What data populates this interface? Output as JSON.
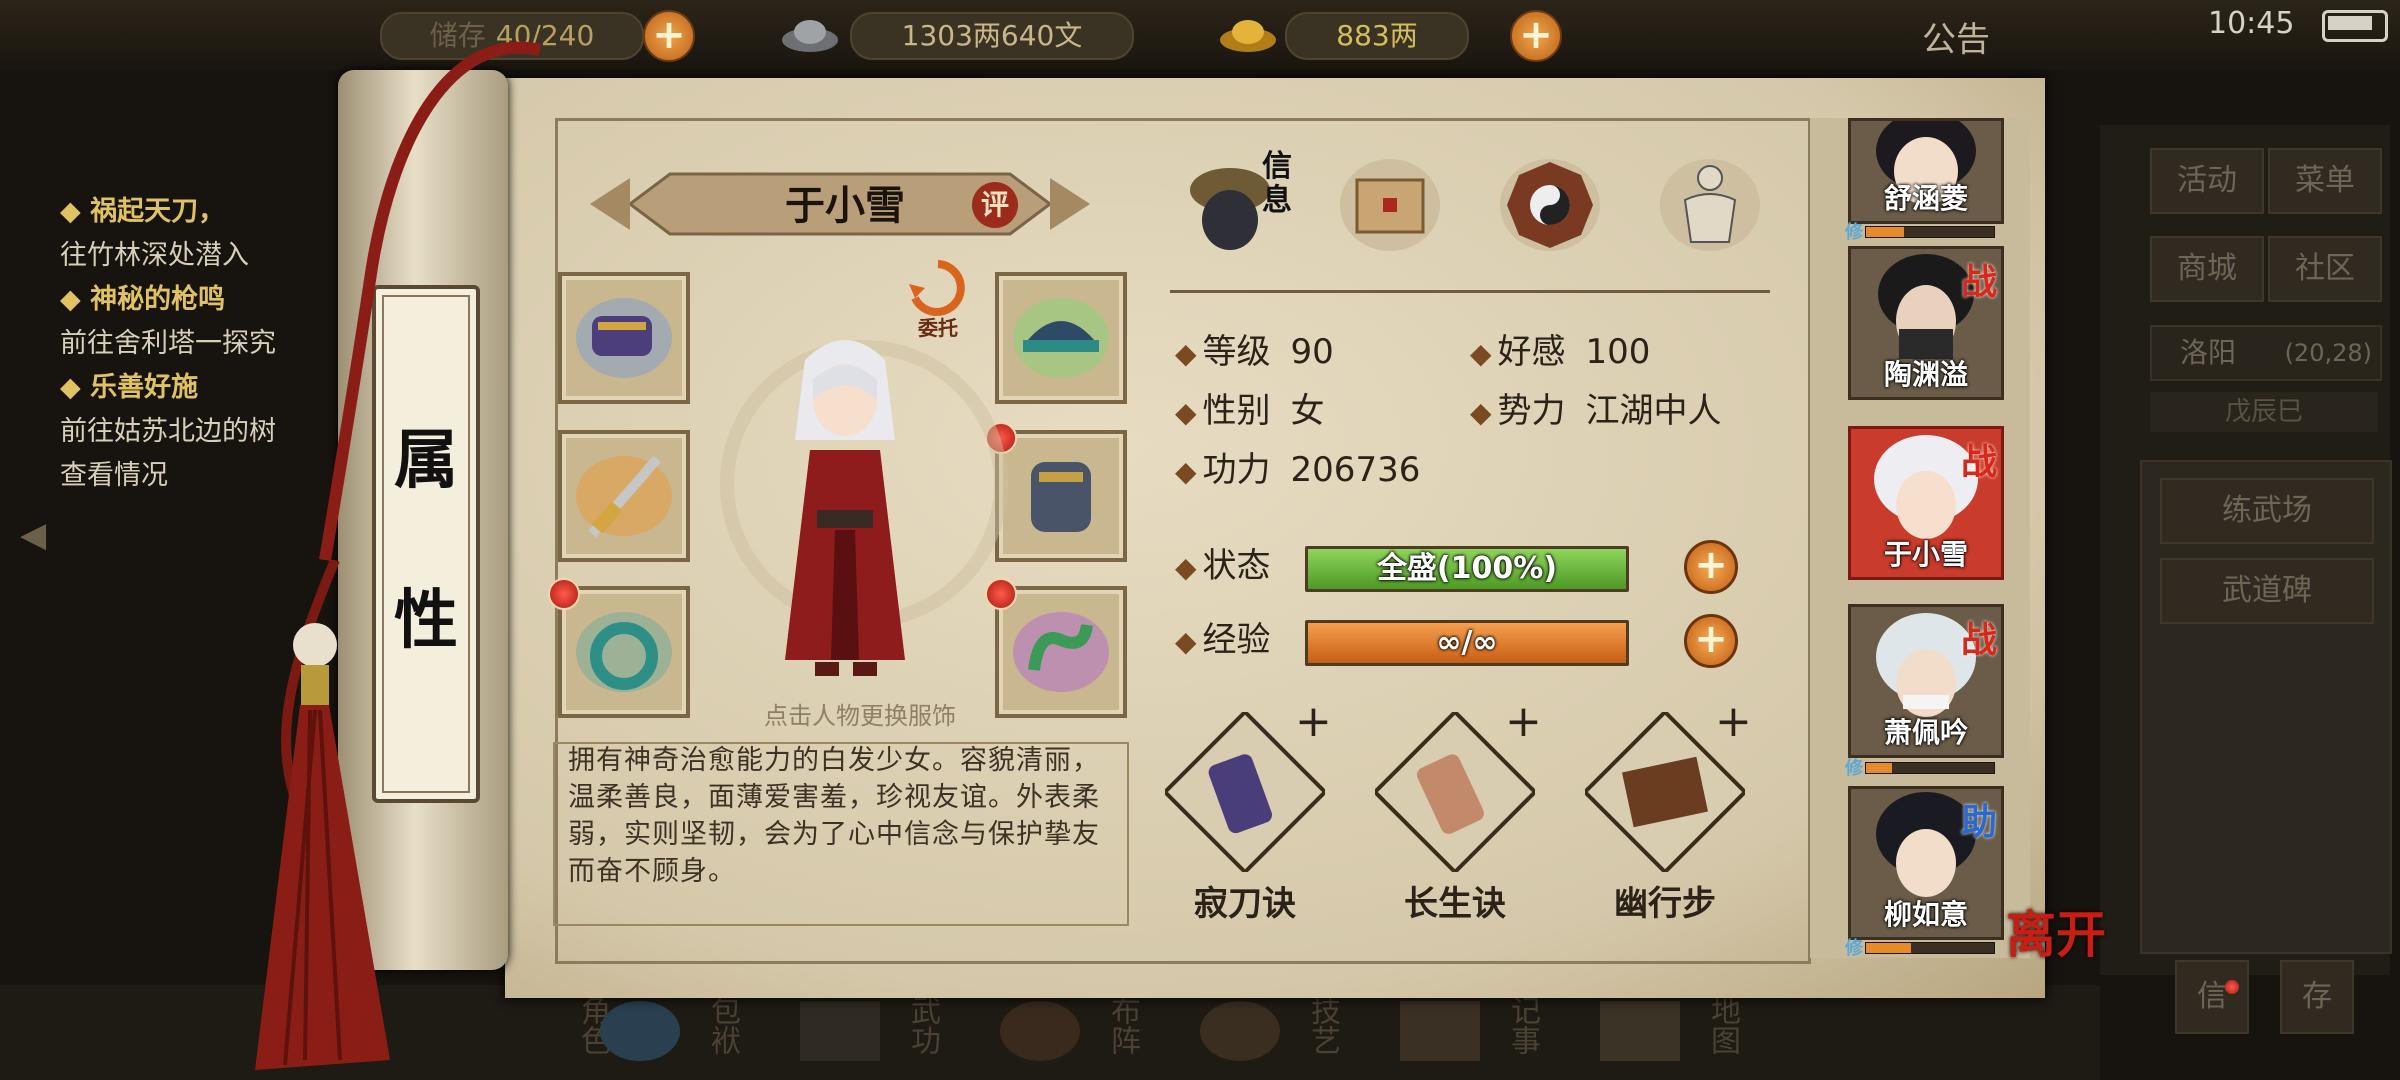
{
  "topbar": {
    "bag_label": "储存",
    "bag_count": "40/240",
    "silver": "1303两640文",
    "gold": "883两",
    "notice": "公告",
    "clock": "10:45"
  },
  "quests": [
    {
      "title": "祸起天刀，",
      "detail": "往竹林深处潜入"
    },
    {
      "title": "神秘的枪鸣",
      "detail": "前往舍利塔一探究"
    },
    {
      "title": "乐善好施",
      "detail": "前往姑苏北边的树",
      "detail2": "查看情况"
    }
  ],
  "scroll_tab": [
    "属",
    "性"
  ],
  "character": {
    "name": "于小雪",
    "rate_badge": "评",
    "commission": "委托",
    "change_hint": "点击人物更换服饰",
    "description": "拥有神奇治愈能力的白发少女。容貌清丽，温柔善良，面薄爱害羞，珍视友谊。外表柔弱，实则坚韧，会为了心中信念与保护挚友而奋不顾身。"
  },
  "tabs": {
    "info_label": "信息"
  },
  "stats": {
    "level_label": "等级",
    "level": "90",
    "favor_label": "好感",
    "favor": "100",
    "gender_label": "性别",
    "gender": "女",
    "faction_label": "势力",
    "faction": "江湖中人",
    "power_label": "功力",
    "power": "206736",
    "status_label": "状态",
    "status_text": "全盛(100%)",
    "status_fill": 1.0,
    "exp_label": "经验",
    "exp_text": "∞/∞",
    "exp_fill": 1.0
  },
  "skills": [
    {
      "name": "寂刀诀"
    },
    {
      "name": "长生诀"
    },
    {
      "name": "幽行步"
    }
  ],
  "party": [
    {
      "name": "舒涵菱",
      "badge": "",
      "xiu": true
    },
    {
      "name": "陶渊溢",
      "badge": "战",
      "xiu": false
    },
    {
      "name": "于小雪",
      "badge": "战",
      "xiu": false
    },
    {
      "name": "萧佩吟",
      "badge": "战",
      "xiu": true
    },
    {
      "name": "柳如意",
      "badge": "助",
      "xiu": true
    }
  ],
  "xiu_label": "修",
  "xiu_fills": [
    0.3,
    0.2,
    0.35
  ],
  "right_menu": {
    "activity": "活动",
    "menu": "菜单",
    "shop": "商城",
    "community": "社区",
    "location": "洛阳",
    "coords": "(20,28)",
    "time": "戊辰巳",
    "training": "练武场",
    "stele": "武道碑",
    "small1": "信",
    "small2": "存"
  },
  "leave_button": "离开",
  "bottom_nav": [
    "角色",
    "包袱",
    "武功",
    "布阵",
    "技艺",
    "记事",
    "地图"
  ],
  "colors": {
    "status_bar": "#5fae32",
    "exp_bar": "#e07a24",
    "badge_red": "#d8281a"
  }
}
